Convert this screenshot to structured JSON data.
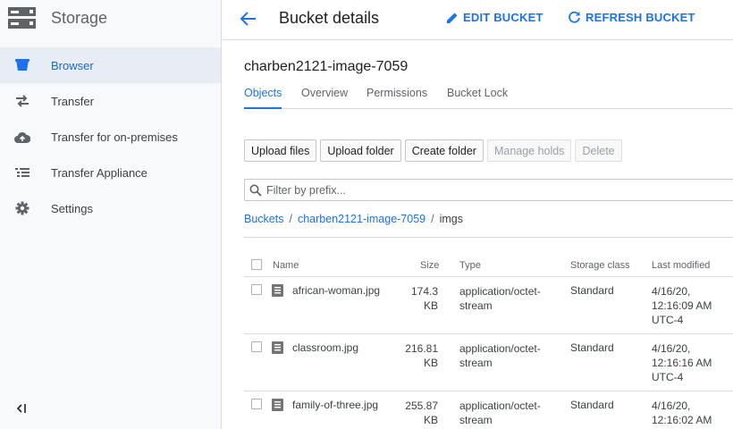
{
  "sidebar": {
    "title": "Storage",
    "items": [
      {
        "label": "Browser",
        "icon": "bucket-icon",
        "active": true
      },
      {
        "label": "Transfer",
        "icon": "transfer-arrows-icon"
      },
      {
        "label": "Transfer for on-premises",
        "icon": "cloud-upload-icon"
      },
      {
        "label": "Transfer Appliance",
        "icon": "list-icon"
      },
      {
        "label": "Settings",
        "icon": "gear-icon"
      }
    ]
  },
  "header": {
    "title": "Bucket details",
    "edit_label": "EDIT BUCKET",
    "refresh_label": "REFRESH BUCKET"
  },
  "bucket": {
    "name": "charben2121-image-7059"
  },
  "tabs": [
    "Objects",
    "Overview",
    "Permissions",
    "Bucket Lock"
  ],
  "toolbar": {
    "upload_files": "Upload files",
    "upload_folder": "Upload folder",
    "create_folder": "Create folder",
    "manage_holds": "Manage holds",
    "delete": "Delete"
  },
  "filter": {
    "placeholder": "Filter by prefix..."
  },
  "breadcrumb": {
    "root": "Buckets",
    "sep": "/",
    "bucket": "charben2121-image-7059",
    "folder": "imgs"
  },
  "table": {
    "columns": [
      "Name",
      "Size",
      "Type",
      "Storage class",
      "Last modified"
    ],
    "rows": [
      {
        "name": "african-woman.jpg",
        "size": "174.3 KB",
        "type": "application/octet-stream",
        "storage_class": "Standard",
        "modified": "4/16/20, 12:16:09 AM UTC-4"
      },
      {
        "name": "classroom.jpg",
        "size": "216.81 KB",
        "type": "application/octet-stream",
        "storage_class": "Standard",
        "modified": "4/16/20, 12:16:16 AM UTC-4"
      },
      {
        "name": "family-of-three.jpg",
        "size": "255.87 KB",
        "type": "application/octet-stream",
        "storage_class": "Standard",
        "modified": "4/16/20, 12:16:02 AM"
      }
    ]
  },
  "colors": {
    "accent": "#1a73e8",
    "sidebar_bg": "#f8f9fa",
    "active_item_bg": "#e8ecf5"
  }
}
